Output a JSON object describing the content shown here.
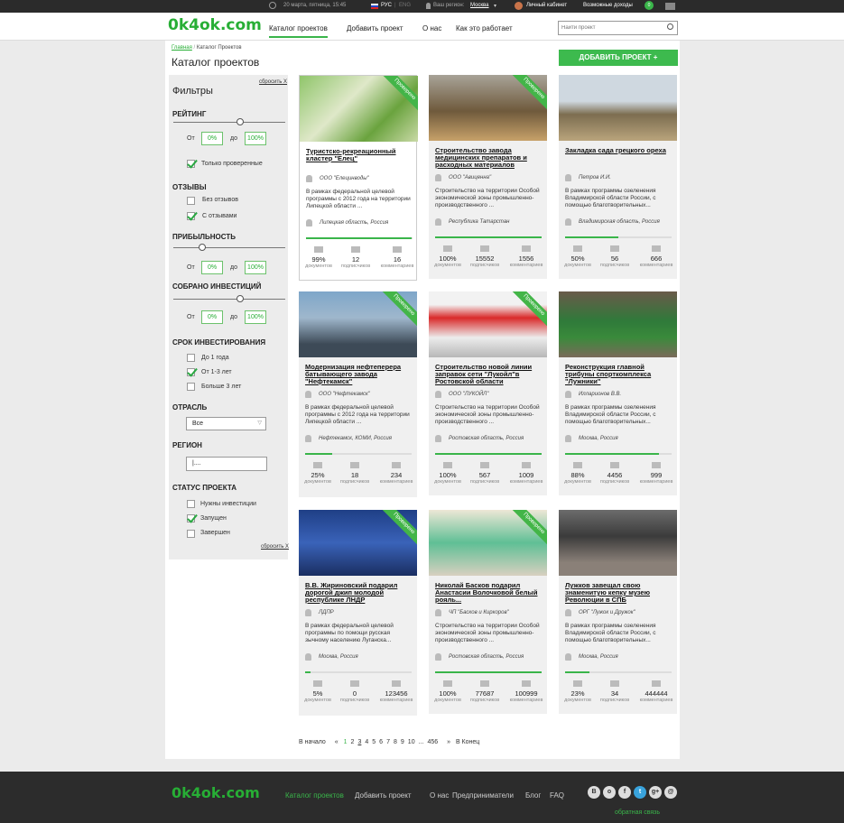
{
  "topbar": {
    "date": "20 марта, пятница, 15:45",
    "lang_ru": "РУС",
    "lang_en": "ENG",
    "region_label": "Ваш регион:",
    "region": "Москва",
    "cabinet": "Личный кабинет",
    "income": "Возможные доходы",
    "badge": "0"
  },
  "header": {
    "logo": "0k4ok.com",
    "nav": [
      "Каталог проектов",
      "Добавить проект",
      "О нас",
      "Как это работает"
    ],
    "search_placeholder": "Найти проект"
  },
  "breadcrumb": {
    "home": "Главная",
    "sep": "/",
    "current": "Каталог Проектов"
  },
  "page_title": "Каталог проектов",
  "add_button": "ДОБАВИТЬ ПРОЕКТ  +",
  "filters": {
    "title": "Фильтры",
    "reset": "сбросить Х",
    "rating": {
      "label": "РЕЙТИНГ",
      "from": "От",
      "to": "до",
      "min": "0%",
      "max": "100%",
      "verified": "Только проверенные"
    },
    "reviews": {
      "label": "ОТЗЫВЫ",
      "opt1": "Без отзывов",
      "opt2": "С отзывами"
    },
    "profit": {
      "label": "ПРИБЫЛЬНОСТЬ",
      "from": "От",
      "to": "до",
      "min": "0%",
      "max": "100%"
    },
    "raised": {
      "label": "СОБРАНО ИНВЕСТИЦИЙ",
      "from": "От",
      "to": "до",
      "min": "0%",
      "max": "100%"
    },
    "term": {
      "label": "СРОК ИНВЕСТИРОВАНИЯ",
      "opt1": "До 1 года",
      "opt2": "От 1-3 лет",
      "opt3": "Больше 3 лет"
    },
    "industry": {
      "label": "ОТРАСЛЬ",
      "value": "Все"
    },
    "region": {
      "label": "РЕГИОН",
      "value": "|...."
    },
    "status": {
      "label": "СТАТУС ПРОЕКТА",
      "opt1": "Нужны инвестиции",
      "opt2": "Запущен",
      "opt3": "Завершен"
    },
    "reset2": "сбросить Х"
  },
  "stat_labels": {
    "docs": "документов",
    "subs": "подписчиков",
    "comments": "комментариев"
  },
  "ribbon": "Проверено",
  "cards": [
    {
      "title": "Туристско-рекреационный кластер \"Елец\"",
      "owner": "ООО \"Елецинводы\"",
      "desc": "В рамках федеральной целевой программы с 2012 года на территории Липецкой области ...",
      "loc": "Липецкая область, Россия",
      "progress": 99,
      "docs": "99%",
      "subs": "12",
      "comments": "16"
    },
    {
      "title": "Строительство завода медицинских препаратов и расходных материалов",
      "owner": "ООО \"Авиценна\"",
      "desc": "Строительство на территории Особой экономической зоны промышленно-производственного ...",
      "loc": "Республика Татарстан",
      "progress": 100,
      "docs": "100%",
      "subs": "15552",
      "comments": "1556"
    },
    {
      "title": "Закладка сада грецкого ореха",
      "owner": "Петров И.И.",
      "desc": "В рамках программы озеленения Владимирской области России, с помощью благотворительных...",
      "loc": "Владимирская область, Россия",
      "progress": 50,
      "docs": "50%",
      "subs": "56",
      "comments": "666"
    },
    {
      "title": "Модернизация нефтеперера батывающего завода \"Нефтекамск\"",
      "owner": "ООО \"Нефтекамск\"",
      "desc": "В рамках федеральной целевой программы с 2012 года на территории Липецкой области ...",
      "loc": "Нефтекамск, КОМИ, Россия",
      "progress": 25,
      "docs": "25%",
      "subs": "18",
      "comments": "234"
    },
    {
      "title": "Строительство новой линии заправок сети \"Лукойл\"в Ростовской области",
      "owner": "ООО \"ЛУКОЙЛ\"",
      "desc": "Строительство на территории Особой экономической зоны промышленно-производственного ...",
      "loc": "Ростовская область, Россия",
      "progress": 100,
      "docs": "100%",
      "subs": "567",
      "comments": "1009"
    },
    {
      "title": "Реконструкция главной трибуны спорткомплекса \"Лужники\"",
      "owner": "Илларионов В.В.",
      "desc": "В рамках программы озеленения Владимирской области России, с помощью благотворительных...",
      "loc": "Москва, Россия",
      "progress": 88,
      "docs": "88%",
      "subs": "4456",
      "comments": "999"
    },
    {
      "title": "В.В. Жириновский подарил дорогой джип молодой республике ЛНДР",
      "owner": "ЛДПР",
      "desc": "В рамках федеральной целевой программы по помощи русская зычному населению Луганска...",
      "loc": "Москва, Россия",
      "progress": 5,
      "docs": "5%",
      "subs": "0",
      "comments": "123456"
    },
    {
      "title": "Николай Басков подарил Анастасии Волочковой белый рояль...",
      "owner": "ЧП \"Басков и Киркоров\"",
      "desc": "Строительство на территории Особой экономической зоны промышленно-производственного ...",
      "loc": "Ростовская область, Россия",
      "progress": 100,
      "docs": "100%",
      "subs": "77687",
      "comments": "100999"
    },
    {
      "title": "Лужков завещал свою знаменитую кепку музею Революции в СПБ",
      "owner": "ОРГ \"Лужок и Дружок\"",
      "desc": "В рамках программы озеленения Владимирской области России, с помощью благотворительных...",
      "loc": "Москва, Россия",
      "progress": 23,
      "docs": "23%",
      "subs": "34",
      "comments": "444444"
    }
  ],
  "pager": {
    "first": "В начало",
    "prev": "«",
    "pages": [
      "1",
      "2",
      "3",
      "4",
      "5",
      "6",
      "7",
      "8",
      "9",
      "10",
      "...",
      "456"
    ],
    "next": "»",
    "last": "В Конец"
  },
  "footer": {
    "logo": "0k4ok.com",
    "nav": [
      "Каталог проектов",
      "Добавить проект",
      "О нас",
      "Предприниматели",
      "Блог",
      "FAQ"
    ],
    "social": [
      "B",
      "o",
      "f",
      "t",
      "g+",
      "@"
    ],
    "feedback": "обратная связь"
  }
}
